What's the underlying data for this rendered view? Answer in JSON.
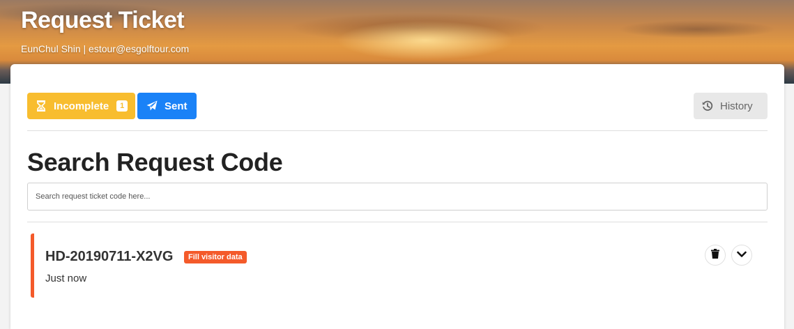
{
  "header": {
    "title": "Request Ticket",
    "user_line": "EunChul Shin | estour@esgolftour.com"
  },
  "toolbar": {
    "incomplete_label": "Incomplete",
    "incomplete_count": "1",
    "sent_label": "Sent",
    "history_label": "History"
  },
  "search": {
    "title": "Search Request Code",
    "placeholder": "Search request ticket code here...",
    "value": ""
  },
  "tickets": [
    {
      "code": "HD-20190711-X2VG",
      "tag": "Fill visitor data",
      "time": "Just now"
    }
  ],
  "colors": {
    "incomplete": "#f8bd2f",
    "sent": "#1a82f7",
    "history": "#e8e8e8",
    "ticket_accent": "#f45a2a"
  },
  "icons": {
    "incomplete": "hourglass-icon",
    "sent": "paper-plane-icon",
    "history": "history-icon",
    "delete": "trash-icon",
    "expand": "chevron-down-icon"
  }
}
